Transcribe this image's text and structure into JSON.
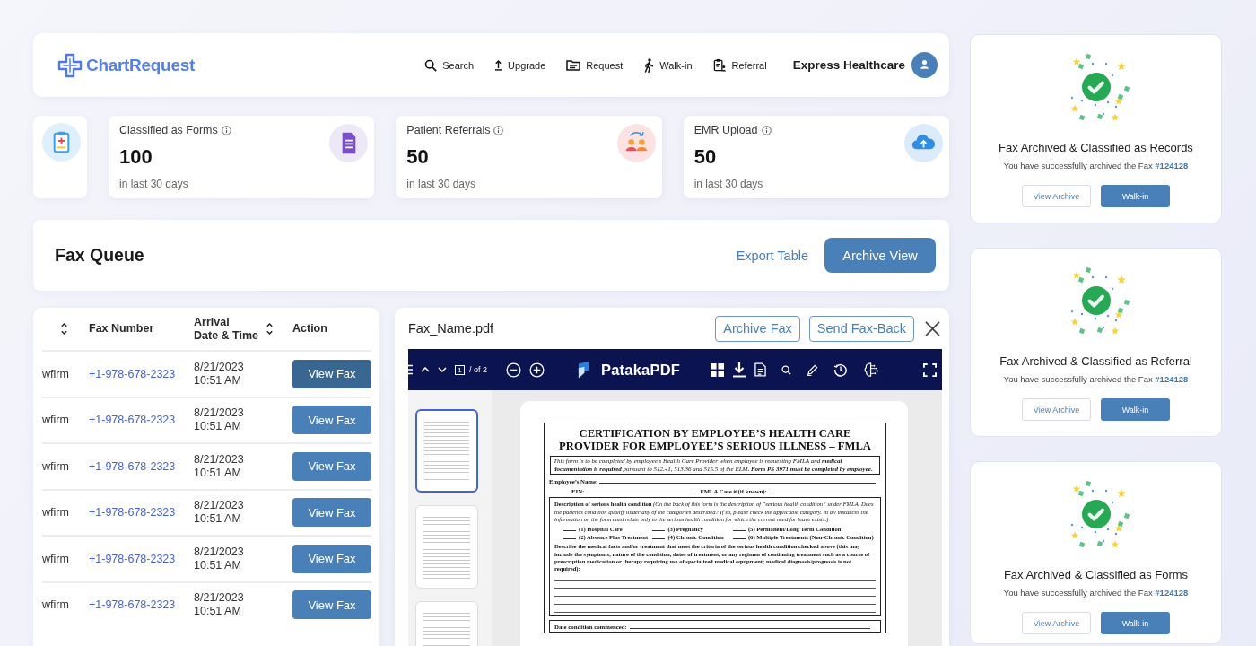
{
  "nav": {
    "logo": "ChartRequest",
    "items": [
      "Search",
      "Upgrade",
      "Request",
      "Walk-in",
      "Referral"
    ],
    "account": "Express Healthcare"
  },
  "stats": [
    {
      "title": "Classified as Forms",
      "value": "100",
      "period": "in last 30 days"
    },
    {
      "title": "Patient Referrals",
      "value": "50",
      "period": "in last 30 days"
    },
    {
      "title": "EMR Upload",
      "value": "50",
      "period": "in last 30 days"
    }
  ],
  "fax_queue": {
    "title": "Fax Queue",
    "link": "Export Table",
    "button": "Archive View"
  },
  "table": {
    "columns": [
      {
        "sortable": true
      },
      {
        "label": "Fax Number",
        "sortable": false
      },
      {
        "label": "Arrival\nDate & Time",
        "sortable": true
      },
      {
        "label": "Action",
        "sortable": false
      }
    ],
    "rows": [
      {
        "sender": "wfirm",
        "fax_number": "+1-978-678-2323",
        "date": "8/21/2023",
        "time": "10:51 AM",
        "action": "View Fax",
        "selected": true
      },
      {
        "sender": "wfirm",
        "fax_number": "+1-978-678-2323",
        "date": "8/21/2023",
        "time": "10:51 AM",
        "action": "View Fax",
        "selected": false
      },
      {
        "sender": "wfirm",
        "fax_number": "+1-978-678-2323",
        "date": "8/21/2023",
        "time": "10:51 AM",
        "action": "View Fax",
        "selected": false
      },
      {
        "sender": "wfirm",
        "fax_number": "+1-978-678-2323",
        "date": "8/21/2023",
        "time": "10:51 AM",
        "action": "View Fax",
        "selected": false
      },
      {
        "sender": "wfirm",
        "fax_number": "+1-978-678-2323",
        "date": "8/21/2023",
        "time": "10:51 AM",
        "action": "View Fax",
        "selected": false
      },
      {
        "sender": "wfirm",
        "fax_number": "+1-978-678-2323",
        "date": "8/21/2023",
        "time": "10:51 AM",
        "action": "View Fax",
        "selected": false
      }
    ]
  },
  "viewer": {
    "file_name": "Fax_Name.pdf",
    "buttons": [
      "Archive Fax",
      "Send Fax-Back"
    ],
    "toolbar": {
      "page": "1",
      "page_count": "/ of 2",
      "brand": "PatakaPDF"
    },
    "thumbnails": [
      {
        "selected": true
      },
      {
        "selected": false
      },
      {
        "selected": false
      }
    ],
    "document": {
      "title": "CERTIFICATION BY EMPLOYEE’S HEALTH CARE PROVIDER FOR EMPLOYEE’S SERIOUS ILLNESS – FMLA",
      "notice": "This form is to be completed by employee’s Health Care Provider when employee is requesting FMLA and **medical documentation is required** pursuant to 512.41, 513.36 and 515.5 of the ELM. **Form PS 3971 must be completed by employee.**",
      "field_rows": [
        [
          "Employee’s Name:"
        ],
        [
          "EIN:",
          "FMLA Case # (if known):"
        ]
      ],
      "description": "**Description of serious health condition** *(On the back of this form is the description of “serious health condition” under FMLA. Does the patient’s condition qualify under any of the categories described? If so, please check the applicable category. In all instances the information on the form must relate only to the serious health condition for which the current need for leave exists.)*",
      "conditions": [
        "(1) Hospital Care",
        "(3) Pregnancy",
        "(5) Permanent/Long Term Condition",
        "(2) Absence Plus Treatment",
        "(4) Chronic Condition",
        "(6) Multiple Treatments (Non-Chronic Condition)"
      ],
      "instructions": "Describe the medical facts and/or treatment that meet the criteria of the serious health condition checked above (this may include the symptoms, nature of the condition, dates of treatment, or any regimen of continuing treatment such as a course of prescription medication or therapy requiring use of specialized medical equipment; medical diagnosis/prognosis is not required):",
      "footer_field": "Date condition commenced:"
    }
  },
  "notifications": [
    {
      "title": "Fax Archived & Classified as Records",
      "message": "You have successfully archived the Fax",
      "fax_number": "#124128",
      "secondary_button": "View Archive",
      "primary_button": "Walk-in"
    },
    {
      "title": "Fax Archived & Classified as Referral",
      "message": "You have successfully archived the Fax",
      "fax_number": "#124128",
      "secondary_button": "View Archive",
      "primary_button": "Walk-in"
    },
    {
      "title": "Fax Archived & Classified as Forms",
      "message": "You have successfully archived the Fax",
      "fax_number": "#124128",
      "secondary_button": "View Archive",
      "primary_button": "Walk-in"
    }
  ]
}
